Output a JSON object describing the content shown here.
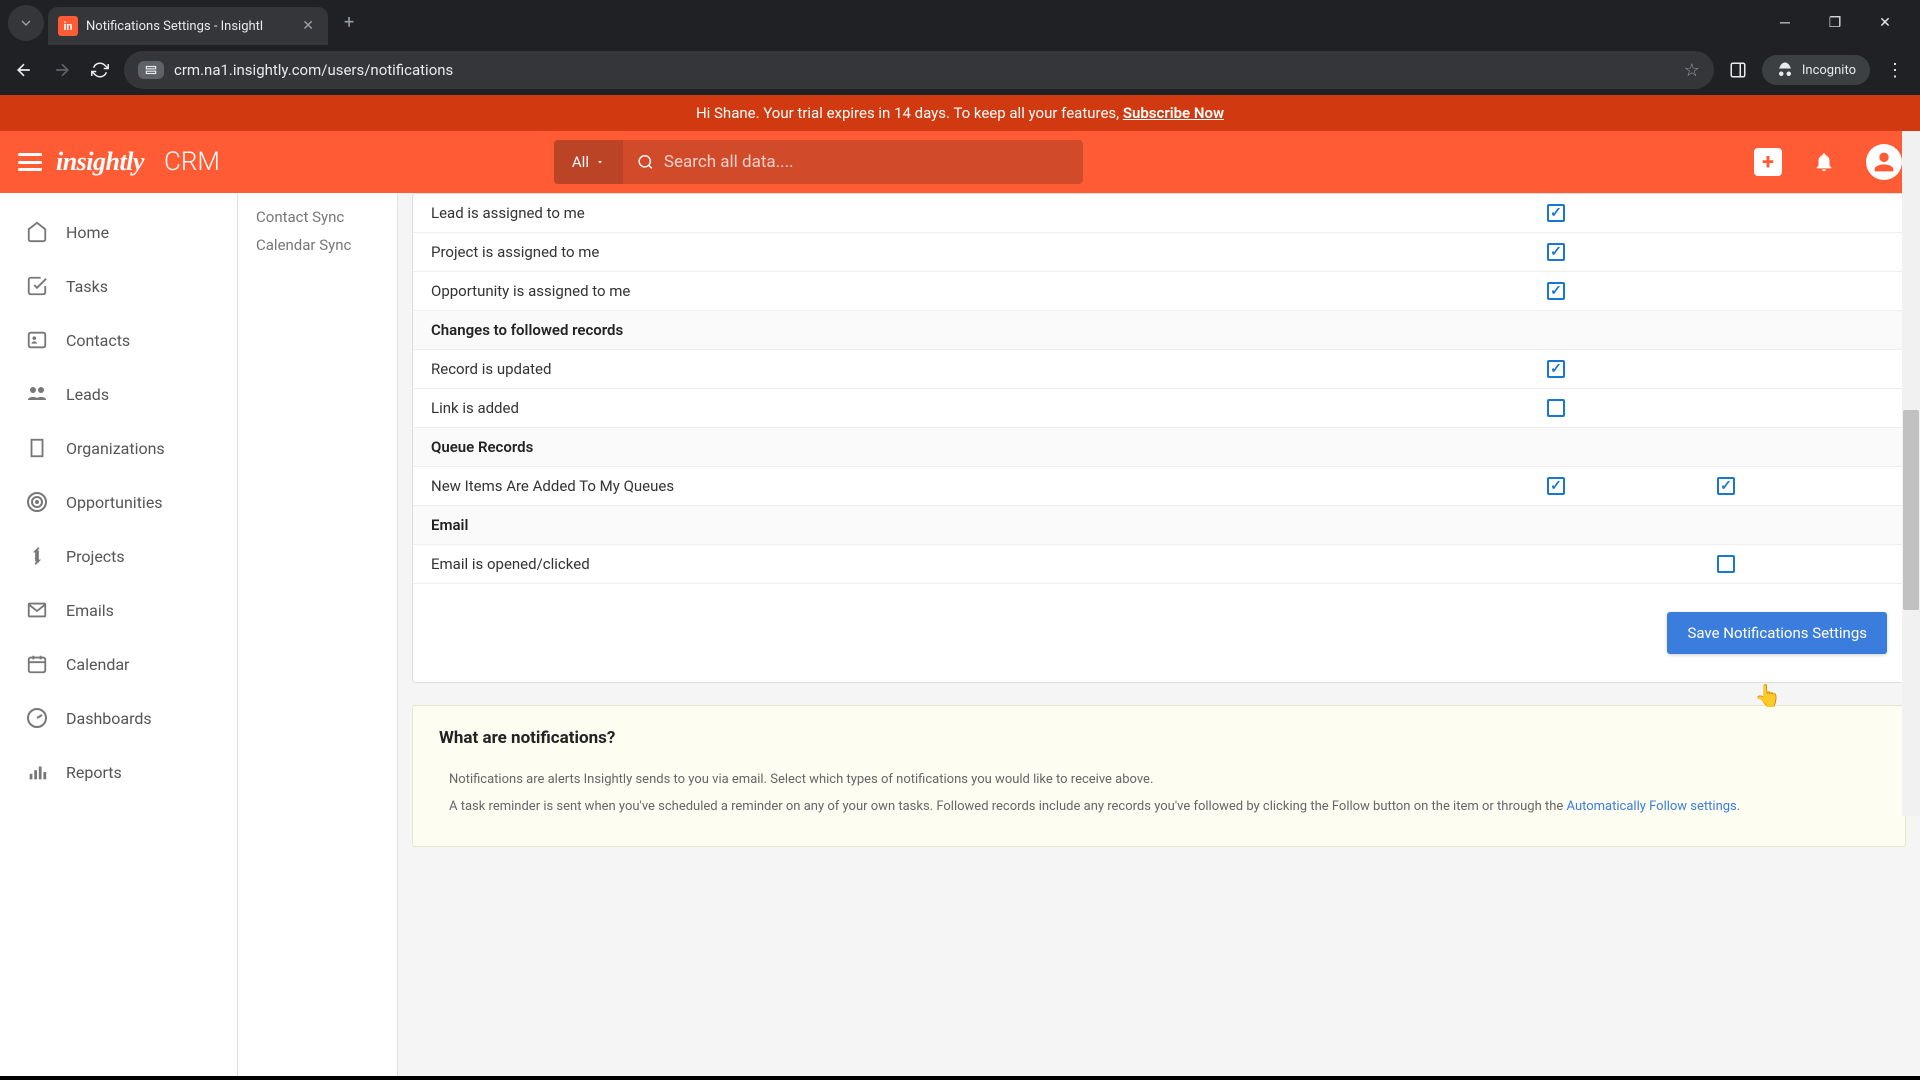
{
  "browser": {
    "tab_title": "Notifications Settings - Insightl",
    "url": "crm.na1.insightly.com/users/notifications",
    "incognito_label": "Incognito"
  },
  "trial": {
    "greeting": "Hi Shane. Your trial expires in 14 days. To keep all your features, ",
    "cta": "Subscribe Now"
  },
  "header": {
    "logo": "insightly",
    "product": "CRM",
    "search_scope": "All",
    "search_placeholder": "Search all data...."
  },
  "nav": {
    "home": "Home",
    "tasks": "Tasks",
    "contacts": "Contacts",
    "leads": "Leads",
    "organizations": "Organizations",
    "opportunities": "Opportunities",
    "projects": "Projects",
    "emails": "Emails",
    "calendar": "Calendar",
    "dashboards": "Dashboards",
    "reports": "Reports"
  },
  "sub_sidebar": {
    "contact_sync": "Contact Sync",
    "calendar_sync": "Calendar Sync"
  },
  "notifications": {
    "rows": {
      "lead_assigned": "Lead is assigned to me",
      "project_assigned": "Project is assigned to me",
      "opportunity_assigned": "Opportunity is assigned to me",
      "changes_hdr": "Changes to followed records",
      "record_updated": "Record is updated",
      "link_added": "Link is added",
      "queue_hdr": "Queue Records",
      "queue_items": "New Items Are Added To My Queues",
      "email_hdr": "Email",
      "email_opened": "Email is opened/clicked"
    },
    "save_button": "Save Notifications Settings"
  },
  "info": {
    "title": "What are notifications?",
    "p1": "Notifications are alerts Insightly sends to you via email. Select which types of notifications you would like to receive above.",
    "p2a": "A task reminder is sent when you've scheduled a reminder on any of your own tasks. Followed records include any records you've followed by clicking the Follow button on the item or through the ",
    "p2_link": "Automatically Follow settings",
    "p2b": "."
  }
}
